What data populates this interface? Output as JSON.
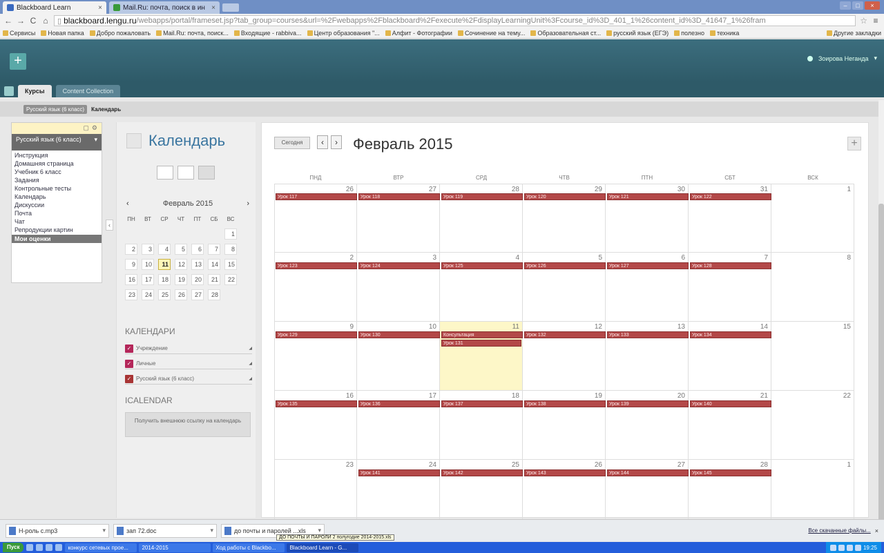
{
  "browser": {
    "tabs": [
      {
        "label": "Blackboard Learn",
        "active": true
      },
      {
        "label": "Mail.Ru: почта, поиск в ин",
        "active": false
      }
    ],
    "url_host": "blackboard.lengu.ru",
    "url_path": "/webapps/portal/frameset.jsp?tab_group=courses&url=%2Fwebapps%2Fblackboard%2Fexecute%2FdisplayLearningUnit%3Fcourse_id%3D_401_1%26content_id%3D_41647_1%26fram",
    "bookmarks": [
      "Сервисы",
      "Новая папка",
      "Добро пожаловать",
      "Mail.Ru: почта, поиск...",
      "Входящие - rabbiva...",
      "Центр образования \"...",
      "Алфит - Фотографии",
      "Сочинение на тему...",
      "Образовательная ст...",
      "русский язык (ЕГЭ)",
      "полезно",
      "техника"
    ],
    "bookmarks_other": "Другие закладки"
  },
  "bb": {
    "user": "Зоирова Неганда",
    "tabs": [
      "Курсы",
      "Content Collection"
    ],
    "breadcrumb": [
      "Русский язык (6 класс)",
      "Календарь"
    ]
  },
  "course_menu": {
    "title": "Русский язык (6 класс)",
    "items": [
      "Инструкция",
      "Домашняя страница",
      "Учебник 6 класс",
      "Задания",
      "Контрольные тесты",
      "Календарь",
      "Дискуссии",
      "Почта",
      "Чат",
      "Репродукции картин"
    ],
    "grades": "Мои оценки"
  },
  "sidebar": {
    "title": "Календарь",
    "mini_month": "Февраль 2015",
    "prev": "‹",
    "next": "›",
    "dows": [
      "ПН",
      "ВТ",
      "СР",
      "ЧТ",
      "ПТ",
      "СБ",
      "ВС"
    ],
    "days": [
      [
        null,
        null,
        null,
        null,
        null,
        null,
        "1"
      ],
      [
        "2",
        "3",
        "4",
        "5",
        "6",
        "7",
        "8"
      ],
      [
        "9",
        "10",
        "11",
        "12",
        "13",
        "14",
        "15"
      ],
      [
        "16",
        "17",
        "18",
        "19",
        "20",
        "21",
        "22"
      ],
      [
        "23",
        "24",
        "25",
        "26",
        "27",
        "28",
        null
      ]
    ],
    "today": "11",
    "calendars_heading": "КАЛЕНДАРИ",
    "calendars": [
      "Учреждение",
      "Личные",
      "Русский язык (6 класс)"
    ],
    "ical_heading": "ICALENDAR",
    "ical_button": "Получить внешнюю ссылку на календарь"
  },
  "calendar": {
    "today_button": "Сегодня",
    "prev": "‹",
    "next": "›",
    "month_title": "Февраль 2015",
    "add": "+",
    "headers": [
      "ПНД",
      "ВТР",
      "СРД",
      "ЧТВ",
      "ПТН",
      "СБТ",
      "ВСК"
    ],
    "weeks": [
      {
        "days": [
          "26",
          "27",
          "28",
          "29",
          "30",
          "31",
          "1"
        ],
        "events": [
          "Урок 117",
          "Урок 118",
          "Урок 119",
          "Урок 120",
          "Урок 121",
          "Урок 122",
          null
        ]
      },
      {
        "days": [
          "2",
          "3",
          "4",
          "5",
          "6",
          "7",
          "8"
        ],
        "events": [
          "Урок 123",
          "Урок 124",
          "Урок 125",
          "Урок 126",
          "Урок 127",
          "Урок 128",
          null
        ]
      },
      {
        "days": [
          "9",
          "10",
          "11",
          "12",
          "13",
          "14",
          "15"
        ],
        "events": [
          "Урок 129",
          "Урок 130",
          "Консультация",
          "Урок 132",
          "Урок 133",
          "Урок 134",
          null
        ]
      },
      {
        "days": [
          "16",
          "17",
          "18",
          "19",
          "20",
          "21",
          "22"
        ],
        "events": [
          "Урок 135",
          "Урок 136",
          "Урок 137",
          "Урок 138",
          "Урок 139",
          "Урок 140",
          null
        ]
      },
      {
        "days": [
          "23",
          "24",
          "25",
          "26",
          "27",
          "28",
          "1"
        ],
        "events": [
          null,
          "Урок 141",
          "Урок 142",
          "Урок 143",
          "Урок 144",
          "Урок 145",
          null
        ]
      }
    ],
    "extra_event": "Урок 131",
    "today_cell": "11"
  },
  "downloads": {
    "items": [
      "Н-роль с.mp3",
      "зап 72.doc",
      "до почты и паролей ...xls"
    ],
    "tooltip": "ДО ПОЧТЫ И ПАРОЛИ 2 полугодие 2014-2015.xls",
    "show_all": "Все скачанные файлы..."
  },
  "taskbar": {
    "start": "Пуск",
    "tasks": [
      "конкурс сетевых прое...",
      "2014-2015",
      "Ход работы с Blackbo...",
      "Blackboard Learn - G..."
    ],
    "clock": "19:25"
  },
  "colors": {
    "event": "#b34848",
    "header": "#2e5a68",
    "today": "#fdf7c8",
    "title": "#3b76a0"
  }
}
